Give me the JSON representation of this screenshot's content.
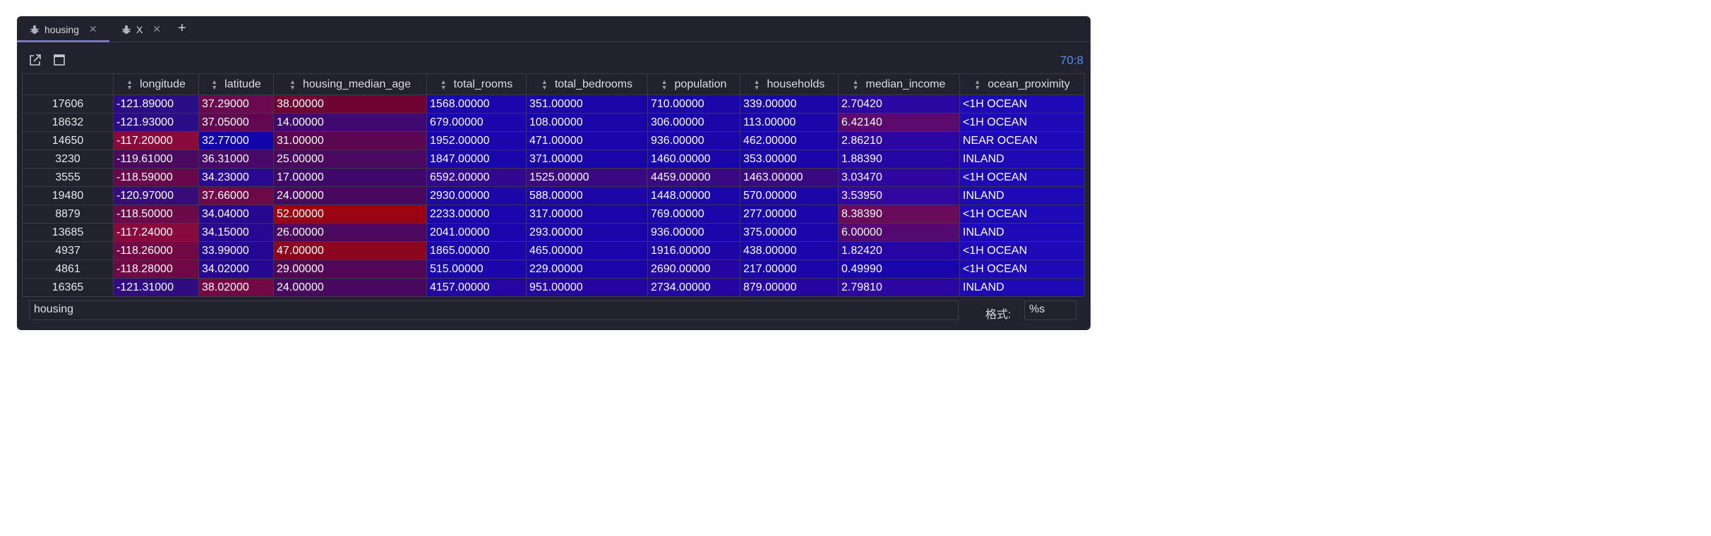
{
  "tabs": [
    {
      "label": "housing",
      "active": true,
      "icon": "bug-icon"
    },
    {
      "label": "X",
      "active": false,
      "icon": "bug-icon"
    }
  ],
  "toolbar": {
    "counter": "70:8"
  },
  "table": {
    "columns": [
      "longitude",
      "latitude",
      "housing_median_age",
      "total_rooms",
      "total_bedrooms",
      "population",
      "households",
      "median_income",
      "ocean_proximity"
    ],
    "rows": [
      {
        "index": "17606",
        "cells": [
          "-121.89000",
          "37.29000",
          "38.00000",
          "1568.00000",
          "351.00000",
          "710.00000",
          "339.00000",
          "2.70420",
          "<1H OCEAN"
        ],
        "colors": [
          "#2a0c86",
          "#6a0850",
          "#6e0230",
          "#1a06aa",
          "#1a06a8",
          "#1a06a8",
          "#1a06a8",
          "#2c06a0",
          "#1d0ab4"
        ]
      },
      {
        "index": "18632",
        "cells": [
          "-121.93000",
          "37.05000",
          "14.00000",
          "679.00000",
          "108.00000",
          "306.00000",
          "113.00000",
          "6.42140",
          "<1H OCEAN"
        ],
        "colors": [
          "#2a0c86",
          "#620850",
          "#3e0a70",
          "#1a06aa",
          "#1a06a8",
          "#1a06a8",
          "#1a06a8",
          "#5a0a6c",
          "#1d0ab4"
        ]
      },
      {
        "index": "14650",
        "cells": [
          "-117.20000",
          "32.77000",
          "31.00000",
          "1952.00000",
          "471.00000",
          "936.00000",
          "462.00000",
          "2.86210",
          "NEAR OCEAN"
        ],
        "colors": [
          "#8a0a3a",
          "#1206aa",
          "#5a0650",
          "#1a06aa",
          "#1a06a8",
          "#1a06a8",
          "#1a06a8",
          "#2c06a0",
          "#1d0ab4"
        ]
      },
      {
        "index": "3230",
        "cells": [
          "-119.61000",
          "36.31000",
          "25.00000",
          "1847.00000",
          "371.00000",
          "1460.00000",
          "353.00000",
          "1.88390",
          "INLAND"
        ],
        "colors": [
          "#4a0a60",
          "#48086a",
          "#4a085e",
          "#1a06aa",
          "#1a06a8",
          "#1a06a8",
          "#1a06a8",
          "#2406a4",
          "#1d0ab4"
        ]
      },
      {
        "index": "3555",
        "cells": [
          "-118.59000",
          "34.23000",
          "17.00000",
          "6592.00000",
          "1525.00000",
          "4459.00000",
          "1463.00000",
          "3.03470",
          "<1H OCEAN"
        ],
        "colors": [
          "#68084c",
          "#2a0890",
          "#40086a",
          "#320890",
          "#3a0880",
          "#3a0880",
          "#3a0880",
          "#2e06a0",
          "#1d0ab4"
        ]
      },
      {
        "index": "19480",
        "cells": [
          "-120.97000",
          "37.66000",
          "24.00000",
          "2930.00000",
          "588.00000",
          "1448.00000",
          "570.00000",
          "3.53950",
          "INLAND"
        ],
        "colors": [
          "#360c78",
          "#6c0848",
          "#48085e",
          "#1e06a6",
          "#1e06a6",
          "#1a06a8",
          "#1e06a6",
          "#3206a0",
          "#1d0ab4"
        ]
      },
      {
        "index": "8879",
        "cells": [
          "-118.50000",
          "34.04000",
          "52.00000",
          "2233.00000",
          "317.00000",
          "769.00000",
          "277.00000",
          "8.38390",
          "<1H OCEAN"
        ],
        "colors": [
          "#6a084a",
          "#260890",
          "#9a0412",
          "#1a06aa",
          "#1a06a8",
          "#1a06a8",
          "#1a06a8",
          "#6a0a5a",
          "#1d0ab4"
        ]
      },
      {
        "index": "13685",
        "cells": [
          "-117.24000",
          "34.15000",
          "26.00000",
          "2041.00000",
          "293.00000",
          "936.00000",
          "375.00000",
          "6.00000",
          "INLAND"
        ],
        "colors": [
          "#880a3c",
          "#280890",
          "#4a085e",
          "#1a06aa",
          "#1a06a8",
          "#1a06a8",
          "#1a06a8",
          "#520a70",
          "#1d0ab4"
        ]
      },
      {
        "index": "4937",
        "cells": [
          "-118.26000",
          "33.99000",
          "47.00000",
          "1865.00000",
          "465.00000",
          "1916.00000",
          "438.00000",
          "1.82420",
          "<1H OCEAN"
        ],
        "colors": [
          "#700846",
          "#240892",
          "#8c0620",
          "#1a06aa",
          "#1a06a8",
          "#1e06a6",
          "#1a06a8",
          "#2406a4",
          "#1d0ab4"
        ]
      },
      {
        "index": "4861",
        "cells": [
          "-118.28000",
          "34.02000",
          "29.00000",
          "515.00000",
          "229.00000",
          "2690.00000",
          "217.00000",
          "0.49990",
          "<1H OCEAN"
        ],
        "colors": [
          "#700846",
          "#240892",
          "#520656",
          "#1a06aa",
          "#1a06a8",
          "#2406a2",
          "#1a06a8",
          "#1806ac",
          "#1d0ab4"
        ]
      },
      {
        "index": "16365",
        "cells": [
          "-121.31000",
          "38.02000",
          "24.00000",
          "4157.00000",
          "951.00000",
          "2734.00000",
          "879.00000",
          "2.79810",
          "INLAND"
        ],
        "colors": [
          "#300c80",
          "#740844",
          "#48085e",
          "#2406a2",
          "#2606a0",
          "#2406a2",
          "#2606a0",
          "#2c06a0",
          "#1d0ab4"
        ]
      }
    ]
  },
  "footer": {
    "expression": "housing",
    "format_label": "格式:",
    "format_value": "%s"
  }
}
